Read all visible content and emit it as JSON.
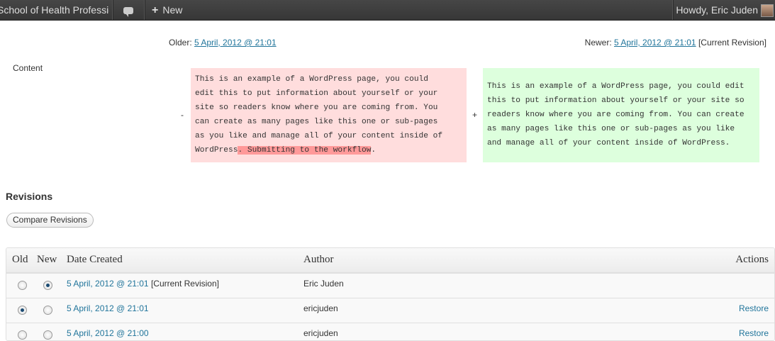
{
  "adminbar": {
    "site_name": "School of Health Professions",
    "comments_icon": "comment-bubble-icon",
    "new_label": "New",
    "howdy": "Howdy, Eric Juden"
  },
  "diff": {
    "older_label": "Older:",
    "older_link": "5 April, 2012 @ 21:01",
    "newer_label": "Newer:",
    "newer_link": "5 April, 2012 @ 21:01",
    "newer_suffix": "[Current Revision]",
    "field_label": "Content",
    "minus": "-",
    "plus": "+",
    "old_lines": [
      "This is an example of a WordPress page, you could",
      "edit this to put information about yourself or your",
      "site so readers know where you are coming from. You",
      "can create as many pages like this one or sub-pages",
      "as you like and manage all of your content inside of"
    ],
    "old_last_prefix": "WordPress",
    "old_deleted": ". Submitting to the workflow",
    "old_last_suffix": ".",
    "new_lines": [
      "This is an example of a WordPress page, you could edit",
      "this to put information about yourself or your site so",
      "readers know where you are coming from. You can create",
      "as many pages like this one or sub-pages as you like",
      "and manage all of your content inside of WordPress."
    ],
    "colors": {
      "deleted_bg": "#ffdddd",
      "added_bg": "#ddffdd",
      "highlight": "#ff9999"
    }
  },
  "revisions": {
    "title": "Revisions",
    "compare_button": "Compare Revisions",
    "columns": {
      "old": "Old",
      "new": "New",
      "date": "Date Created",
      "author": "Author",
      "actions": "Actions"
    },
    "rows": [
      {
        "date": "5 April, 2012 @ 21:01",
        "suffix": "[Current Revision]",
        "author": "Eric Juden",
        "action": "",
        "old_checked": false,
        "new_checked": true
      },
      {
        "date": "5 April, 2012 @ 21:01",
        "suffix": "",
        "author": "ericjuden",
        "action": "Restore",
        "old_checked": true,
        "new_checked": false
      },
      {
        "date": "5 April, 2012 @ 21:00",
        "suffix": "",
        "author": "ericjuden",
        "action": "Restore",
        "old_checked": false,
        "new_checked": false
      }
    ]
  }
}
